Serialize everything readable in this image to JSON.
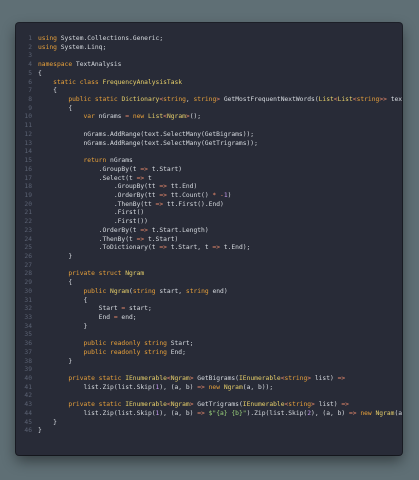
{
  "colors": {
    "background": "#5f6f75",
    "editor_background": "#282b37",
    "line_number": "#5b6273",
    "keyword": "#e9a13a",
    "type": "#e8d06a",
    "text": "#d7dbe0",
    "string": "#9ad17b",
    "operator": "#e98a6b",
    "number": "#c69cf0"
  },
  "lines": [
    {
      "n": "1",
      "tokens": [
        [
          "kw",
          "using"
        ],
        [
          "tx",
          " System.Collections.Generic;"
        ]
      ]
    },
    {
      "n": "2",
      "tokens": [
        [
          "kw",
          "using"
        ],
        [
          "tx",
          " System.Linq;"
        ]
      ]
    },
    {
      "n": "3",
      "tokens": []
    },
    {
      "n": "4",
      "tokens": [
        [
          "kw",
          "namespace"
        ],
        [
          "tx",
          " TextAnalysis"
        ]
      ]
    },
    {
      "n": "5",
      "tokens": [
        [
          "tx",
          "{"
        ]
      ]
    },
    {
      "n": "6",
      "tokens": [
        [
          "tx",
          "    "
        ],
        [
          "kw",
          "static class"
        ],
        [
          "tx",
          " "
        ],
        [
          "type",
          "FrequencyAnalysisTask"
        ]
      ]
    },
    {
      "n": "7",
      "tokens": [
        [
          "tx",
          "    {"
        ]
      ]
    },
    {
      "n": "8",
      "tokens": [
        [
          "tx",
          "        "
        ],
        [
          "kw",
          "public static"
        ],
        [
          "tx",
          " "
        ],
        [
          "type",
          "Dictionary"
        ],
        [
          "op",
          "<"
        ],
        [
          "kw",
          "string"
        ],
        [
          "tx",
          ", "
        ],
        [
          "kw",
          "string"
        ],
        [
          "op",
          ">"
        ],
        [
          "tx",
          " GetMostFrequentNextWords("
        ],
        [
          "type",
          "List"
        ],
        [
          "op",
          "<"
        ],
        [
          "type",
          "List"
        ],
        [
          "op",
          "<"
        ],
        [
          "kw",
          "string"
        ],
        [
          "op",
          ">>"
        ],
        [
          "tx",
          " text)"
        ]
      ]
    },
    {
      "n": "9",
      "tokens": [
        [
          "tx",
          "        {"
        ]
      ]
    },
    {
      "n": "10",
      "tokens": [
        [
          "tx",
          "            "
        ],
        [
          "kw",
          "var"
        ],
        [
          "tx",
          " nGrams "
        ],
        [
          "op",
          "="
        ],
        [
          "tx",
          " "
        ],
        [
          "kw",
          "new"
        ],
        [
          "tx",
          " "
        ],
        [
          "type",
          "List"
        ],
        [
          "op",
          "<"
        ],
        [
          "type",
          "Ngram"
        ],
        [
          "op",
          ">"
        ],
        [
          "tx",
          "();"
        ]
      ]
    },
    {
      "n": "11",
      "tokens": []
    },
    {
      "n": "12",
      "tokens": [
        [
          "tx",
          "            nGrams.AddRange(text.SelectMany(GetBigrams));"
        ]
      ]
    },
    {
      "n": "13",
      "tokens": [
        [
          "tx",
          "            nGrams.AddRange(text.SelectMany(GetTrigrams));"
        ]
      ]
    },
    {
      "n": "14",
      "tokens": []
    },
    {
      "n": "15",
      "tokens": [
        [
          "tx",
          "            "
        ],
        [
          "kw",
          "return"
        ],
        [
          "tx",
          " nGrams"
        ]
      ]
    },
    {
      "n": "16",
      "tokens": [
        [
          "tx",
          "                .GroupBy(t "
        ],
        [
          "op",
          "=>"
        ],
        [
          "tx",
          " t.Start)"
        ]
      ]
    },
    {
      "n": "17",
      "tokens": [
        [
          "tx",
          "                .Select(t "
        ],
        [
          "op",
          "=>"
        ],
        [
          "tx",
          " t"
        ]
      ]
    },
    {
      "n": "18",
      "tokens": [
        [
          "tx",
          "                    .GroupBy(tt "
        ],
        [
          "op",
          "=>"
        ],
        [
          "tx",
          " tt.End)"
        ]
      ]
    },
    {
      "n": "19",
      "tokens": [
        [
          "tx",
          "                    .OrderBy(tt "
        ],
        [
          "op",
          "=>"
        ],
        [
          "tx",
          " tt.Count() "
        ],
        [
          "op",
          "*"
        ],
        [
          "tx",
          " "
        ],
        [
          "op",
          "-"
        ],
        [
          "num",
          "1"
        ],
        [
          "tx",
          ")"
        ]
      ]
    },
    {
      "n": "20",
      "tokens": [
        [
          "tx",
          "                    .ThenBy(tt "
        ],
        [
          "op",
          "=>"
        ],
        [
          "tx",
          " tt.First().End)"
        ]
      ]
    },
    {
      "n": "21",
      "tokens": [
        [
          "tx",
          "                    .First()"
        ]
      ]
    },
    {
      "n": "22",
      "tokens": [
        [
          "tx",
          "                    .First())"
        ]
      ]
    },
    {
      "n": "23",
      "tokens": [
        [
          "tx",
          "                .OrderBy(t "
        ],
        [
          "op",
          "=>"
        ],
        [
          "tx",
          " t.Start.Length)"
        ]
      ]
    },
    {
      "n": "24",
      "tokens": [
        [
          "tx",
          "                .ThenBy(t "
        ],
        [
          "op",
          "=>"
        ],
        [
          "tx",
          " t.Start)"
        ]
      ]
    },
    {
      "n": "25",
      "tokens": [
        [
          "tx",
          "                .ToDictionary(t "
        ],
        [
          "op",
          "=>"
        ],
        [
          "tx",
          " t.Start, t "
        ],
        [
          "op",
          "=>"
        ],
        [
          "tx",
          " t.End);"
        ]
      ]
    },
    {
      "n": "26",
      "tokens": [
        [
          "tx",
          "        }"
        ]
      ]
    },
    {
      "n": "27",
      "tokens": []
    },
    {
      "n": "28",
      "tokens": [
        [
          "tx",
          "        "
        ],
        [
          "kw",
          "private struct"
        ],
        [
          "tx",
          " "
        ],
        [
          "type",
          "Ngram"
        ]
      ]
    },
    {
      "n": "29",
      "tokens": [
        [
          "tx",
          "        {"
        ]
      ]
    },
    {
      "n": "30",
      "tokens": [
        [
          "tx",
          "            "
        ],
        [
          "kw",
          "public"
        ],
        [
          "tx",
          " "
        ],
        [
          "type",
          "Ngram"
        ],
        [
          "tx",
          "("
        ],
        [
          "kw",
          "string"
        ],
        [
          "tx",
          " start, "
        ],
        [
          "kw",
          "string"
        ],
        [
          "tx",
          " end)"
        ]
      ]
    },
    {
      "n": "31",
      "tokens": [
        [
          "tx",
          "            {"
        ]
      ]
    },
    {
      "n": "32",
      "tokens": [
        [
          "tx",
          "                Start "
        ],
        [
          "op",
          "="
        ],
        [
          "tx",
          " start;"
        ]
      ]
    },
    {
      "n": "33",
      "tokens": [
        [
          "tx",
          "                End "
        ],
        [
          "op",
          "="
        ],
        [
          "tx",
          " end;"
        ]
      ]
    },
    {
      "n": "34",
      "tokens": [
        [
          "tx",
          "            }"
        ]
      ]
    },
    {
      "n": "35",
      "tokens": []
    },
    {
      "n": "36",
      "tokens": [
        [
          "tx",
          "            "
        ],
        [
          "kw",
          "public readonly"
        ],
        [
          "tx",
          " "
        ],
        [
          "kw",
          "string"
        ],
        [
          "tx",
          " Start;"
        ]
      ]
    },
    {
      "n": "37",
      "tokens": [
        [
          "tx",
          "            "
        ],
        [
          "kw",
          "public readonly"
        ],
        [
          "tx",
          " "
        ],
        [
          "kw",
          "string"
        ],
        [
          "tx",
          " End;"
        ]
      ]
    },
    {
      "n": "38",
      "tokens": [
        [
          "tx",
          "        }"
        ]
      ]
    },
    {
      "n": "39",
      "tokens": []
    },
    {
      "n": "40",
      "tokens": [
        [
          "tx",
          "        "
        ],
        [
          "kw",
          "private static"
        ],
        [
          "tx",
          " "
        ],
        [
          "type",
          "IEnumerable"
        ],
        [
          "op",
          "<"
        ],
        [
          "type",
          "Ngram"
        ],
        [
          "op",
          ">"
        ],
        [
          "tx",
          " GetBigrams("
        ],
        [
          "type",
          "IEnumerable"
        ],
        [
          "op",
          "<"
        ],
        [
          "kw",
          "string"
        ],
        [
          "op",
          ">"
        ],
        [
          "tx",
          " list) "
        ],
        [
          "op",
          "=>"
        ]
      ]
    },
    {
      "n": "41",
      "tokens": [
        [
          "tx",
          "            list.Zip(list.Skip("
        ],
        [
          "num",
          "1"
        ],
        [
          "tx",
          "), (a, b) "
        ],
        [
          "op",
          "=>"
        ],
        [
          "tx",
          " "
        ],
        [
          "kw",
          "new"
        ],
        [
          "tx",
          " "
        ],
        [
          "type",
          "Ngram"
        ],
        [
          "tx",
          "(a, b));"
        ]
      ]
    },
    {
      "n": "42",
      "tokens": []
    },
    {
      "n": "43",
      "tokens": [
        [
          "tx",
          "        "
        ],
        [
          "kw",
          "private static"
        ],
        [
          "tx",
          " "
        ],
        [
          "type",
          "IEnumerable"
        ],
        [
          "op",
          "<"
        ],
        [
          "type",
          "Ngram"
        ],
        [
          "op",
          ">"
        ],
        [
          "tx",
          " GetTrigrams("
        ],
        [
          "type",
          "IEnumerable"
        ],
        [
          "op",
          "<"
        ],
        [
          "kw",
          "string"
        ],
        [
          "op",
          ">"
        ],
        [
          "tx",
          " list) "
        ],
        [
          "op",
          "=>"
        ]
      ]
    },
    {
      "n": "44",
      "tokens": [
        [
          "tx",
          "            list.Zip(list.Skip("
        ],
        [
          "num",
          "1"
        ],
        [
          "tx",
          "), (a, b) "
        ],
        [
          "op",
          "=>"
        ],
        [
          "tx",
          " "
        ],
        [
          "str",
          "$\"{a} {b}\""
        ],
        [
          "tx",
          ").Zip(list.Skip("
        ],
        [
          "num",
          "2"
        ],
        [
          "tx",
          "), (a, b) "
        ],
        [
          "op",
          "=>"
        ],
        [
          "tx",
          " "
        ],
        [
          "kw",
          "new"
        ],
        [
          "tx",
          " "
        ],
        [
          "type",
          "Ngram"
        ],
        [
          "tx",
          "(a, b));"
        ]
      ]
    },
    {
      "n": "45",
      "tokens": [
        [
          "tx",
          "    }"
        ]
      ]
    },
    {
      "n": "46",
      "tokens": [
        [
          "tx",
          "}"
        ]
      ]
    }
  ]
}
